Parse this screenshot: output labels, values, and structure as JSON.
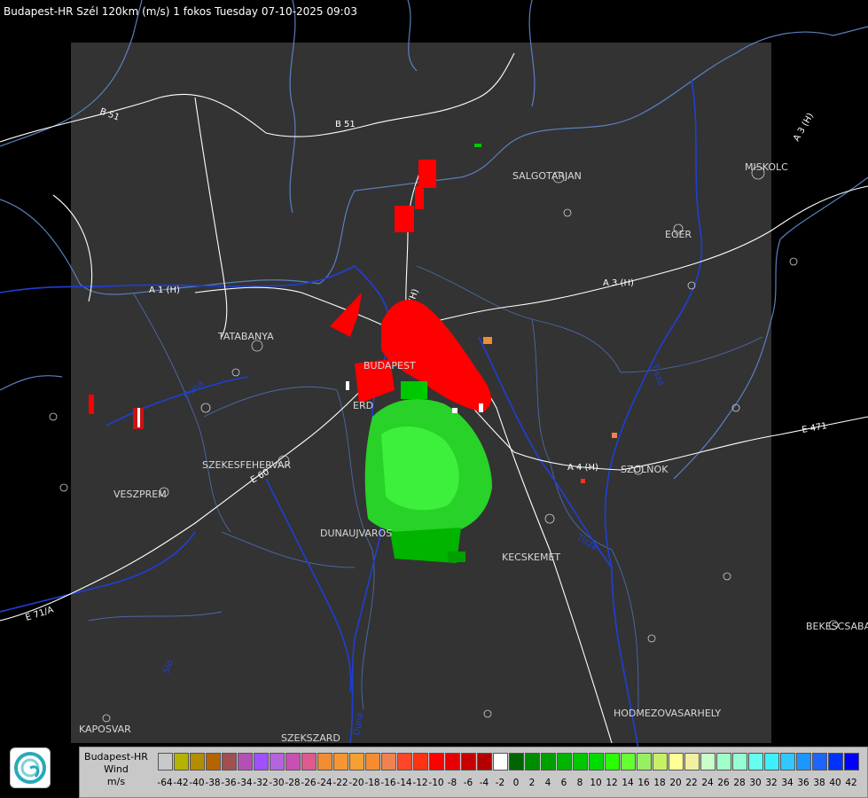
{
  "title": "Budapest-HR Szél 120km (m/s) 1 fokos Tuesday 07-10-2025 09:03",
  "colors": {
    "background": "#000000",
    "radar_area": "#333333",
    "rivers": "#1f3fd6",
    "roads": "#ffffff",
    "borders": "#5a7fc0"
  },
  "places": [
    "SALGOTARJAN",
    "MISKOLC",
    "EGER",
    "TATABANYA",
    "BUDAPEST",
    "ERD",
    "SZEKESFEHERVAR",
    "VESZPREM",
    "DUNAUJVAROS",
    "KECSKEMET",
    "SZOLNOK",
    "BEKESCSABA",
    "HODMEZOVASARHELY",
    "KAPOSVAR",
    "SZEKSZARD"
  ],
  "roads": [
    "B 51",
    "B 51",
    "A 3 (H)",
    "A 3 (H)",
    "A 4 (H)",
    "E 471",
    "E 71/A",
    "A 1 (H)",
    "A 2 (H)",
    "E 60"
  ],
  "rivers": [
    "Duna",
    "Tisza",
    "Zagyva",
    "Sio"
  ],
  "legend": {
    "station": "Budapest-HR",
    "quantity": "Wind",
    "unit": "m/s",
    "colors": [
      "#c8c8c8",
      "#b4b400",
      "#b48c00",
      "#b46400",
      "#a05050",
      "#b450b4",
      "#a050ff",
      "#b464dc",
      "#c850b4",
      "#dc5a8c",
      "#f08c32",
      "#f59632",
      "#f5a032",
      "#f58c32",
      "#ef8250",
      "#ff4628",
      "#ff3214",
      "#ff0000",
      "#e60000",
      "#c80000",
      "#b40000",
      "#ffffff",
      "#006400",
      "#008c00",
      "#00a000",
      "#00b400",
      "#00c800",
      "#00dc00",
      "#28ff00",
      "#64ff32",
      "#96f064",
      "#c8f064",
      "#ffff96",
      "#f0f0a0",
      "#c8ffc8",
      "#a0ffc8",
      "#96ffd2",
      "#64fff0",
      "#3cf0ff",
      "#32c8ff",
      "#1e96ff",
      "#1e64ff",
      "#0032ff",
      "#0000ff"
    ],
    "ticks": [
      "-64",
      "-42",
      "-40",
      "-38",
      "-36",
      "-34",
      "-32",
      "-30",
      "-28",
      "-26",
      "-24",
      "-22",
      "-20",
      "-18",
      "-16",
      "-14",
      "-12",
      "-10",
      "-8",
      "-6",
      "-4",
      "-2",
      "0",
      "2",
      "4",
      "6",
      "8",
      "10",
      "12",
      "14",
      "16",
      "18",
      "20",
      "22",
      "24",
      "26",
      "28",
      "30",
      "32",
      "34",
      "36",
      "38",
      "40",
      "42"
    ]
  }
}
